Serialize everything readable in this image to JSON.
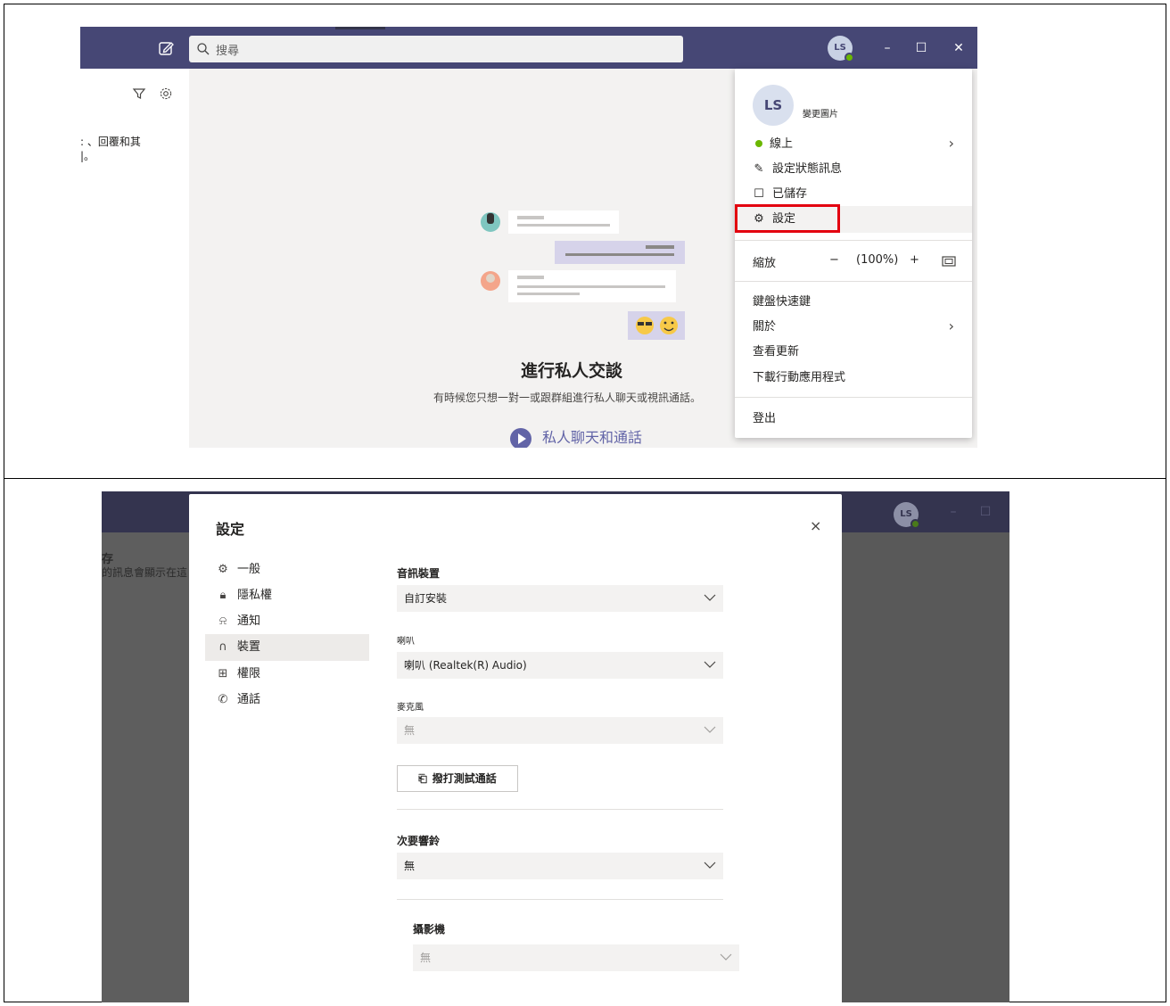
{
  "top": {
    "search_placeholder": "搜尋",
    "avatar_initials": "LS",
    "win_minimize": "–",
    "win_maximize": "☐",
    "win_close": "✕",
    "left_snippet_line1": ": 、回覆和其",
    "left_snippet_line2": "|。",
    "main": {
      "title": "進行私人交談",
      "subtitle": "有時候您只想一對一或跟群組進行私人聊天或視訊通話。",
      "link": "私人聊天和通話"
    },
    "menu": {
      "avatar_initials": "LS",
      "change_picture": "變更圖片",
      "status": "線上",
      "set_status_message": "設定狀態訊息",
      "saved": "已儲存",
      "settings": "設定",
      "zoom_label": "縮放",
      "zoom_minus": "−",
      "zoom_value": "(100%)",
      "zoom_plus": "+",
      "keyboard_shortcuts": "鍵盤快速鍵",
      "about": "關於",
      "check_updates": "查看更新",
      "download_mobile": "下載行動應用程式",
      "sign_out": "登出"
    },
    "colors": {
      "titlebar": "#464775",
      "accent": "#6264a7",
      "presence": "#6bb700",
      "highlight": "#e3000f"
    }
  },
  "bottom": {
    "avatar_initials": "LS",
    "win_minimize": "–",
    "win_maximize": "☐",
    "left_snippet_line1": "存",
    "left_snippet_line2": "的訊息會顯示在這",
    "dialog": {
      "title": "設定",
      "close": "×",
      "nav": [
        {
          "label": "一般",
          "icon": "gear-icon"
        },
        {
          "label": "隱私權",
          "icon": "lock-icon"
        },
        {
          "label": "通知",
          "icon": "bell-icon"
        },
        {
          "label": "裝置",
          "icon": "headset-icon",
          "active": true
        },
        {
          "label": "權限",
          "icon": "apps-icon"
        },
        {
          "label": "通話",
          "icon": "phone-icon"
        }
      ],
      "audio_devices_label": "音訊裝置",
      "audio_devices_value": "自訂安裝",
      "speaker_label": "喇叭",
      "speaker_value": "喇叭 (Realtek(R) Audio)",
      "mic_label": "麥克風",
      "mic_value": "無",
      "test_call": "撥打測試通話",
      "secondary_ringer_label": "次要響鈴",
      "secondary_ringer_value": "無",
      "camera_label": "攝影機",
      "camera_value": "無"
    }
  }
}
